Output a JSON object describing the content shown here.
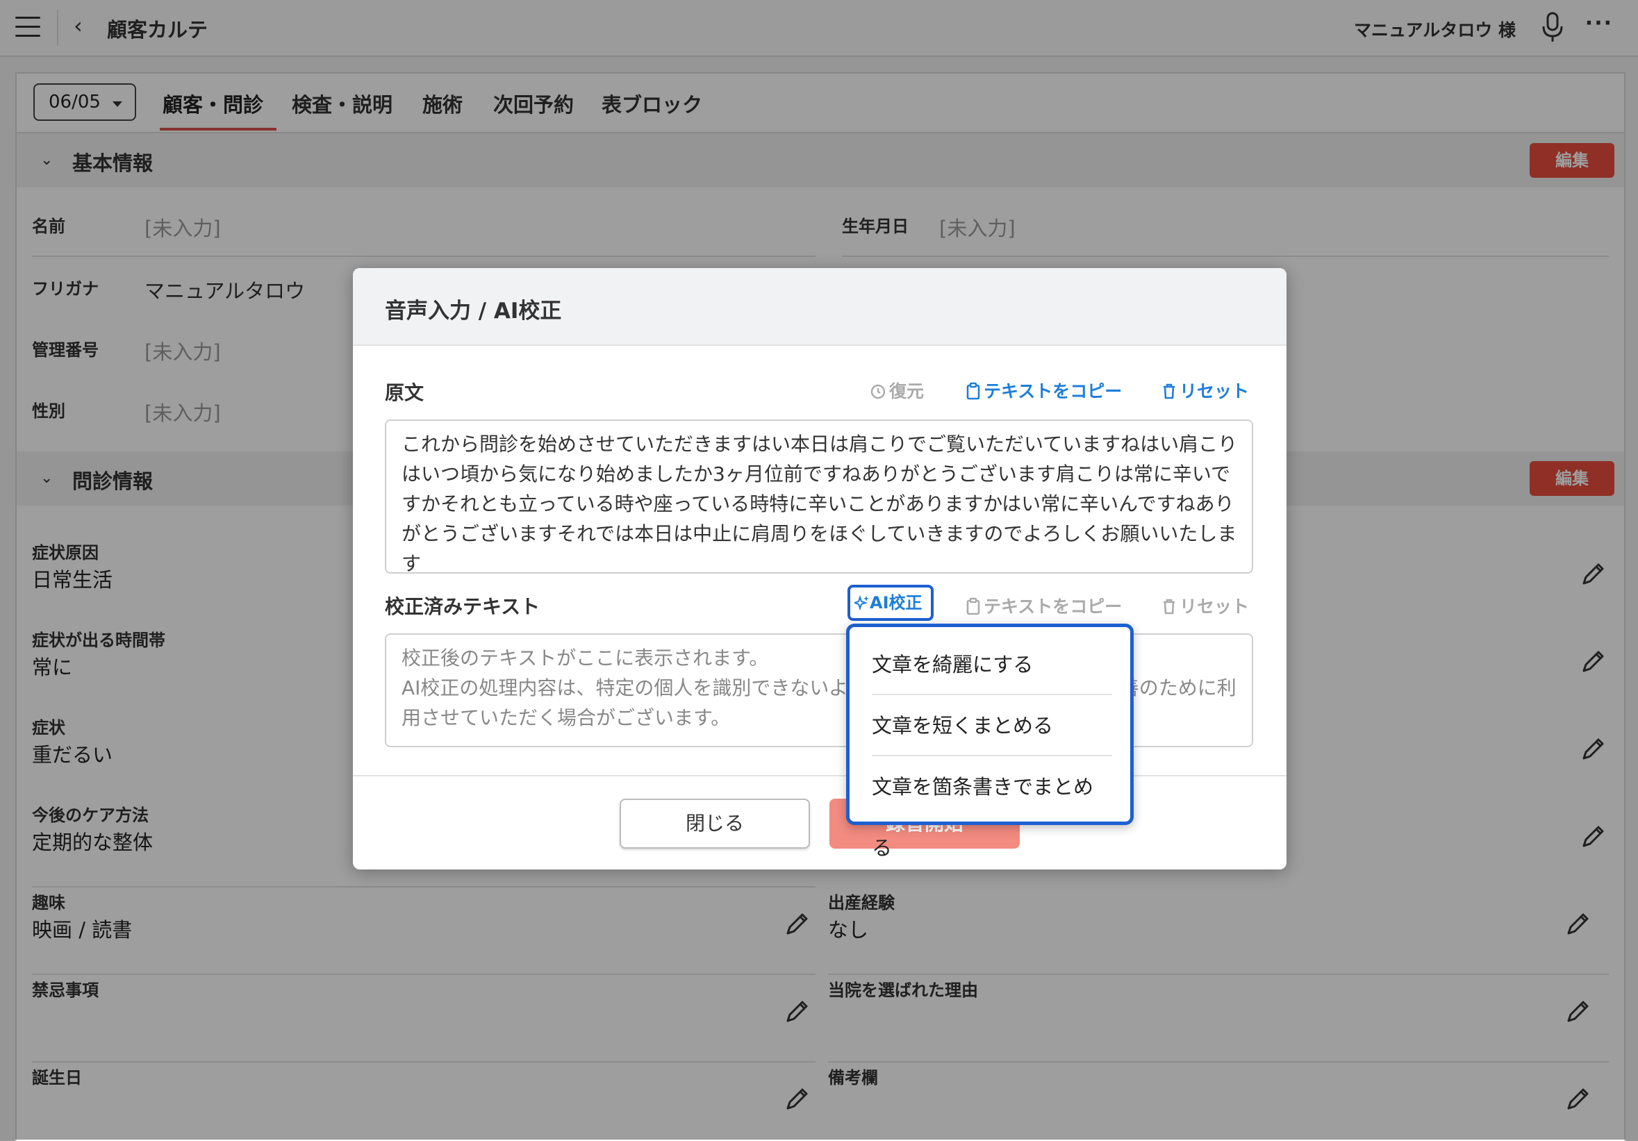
{
  "topbar": {
    "title": "顧客カルテ",
    "user": "マニュアルタロウ 様",
    "more": "···"
  },
  "tabs": {
    "date": "06/05",
    "items": [
      "顧客・問診",
      "検査・説明",
      "施術",
      "次回予約",
      "表ブロック"
    ]
  },
  "basic": {
    "header": "基本情報",
    "edit": "編集",
    "fields": [
      {
        "label": "名前",
        "value": "[未入力]"
      },
      {
        "label": "生年月日",
        "value": "[未入力]"
      },
      {
        "label": "フリガナ",
        "value": "マニュアルタロウ"
      },
      {
        "label": "管理番号",
        "value": "[未入力]"
      },
      {
        "label": "性別",
        "value": "[未入力]"
      }
    ]
  },
  "interview": {
    "header": "問診情報",
    "edit": "編集",
    "left": [
      {
        "label": "症状原因",
        "value": "日常生活"
      },
      {
        "label": "症状が出る時間帯",
        "value": "常に"
      },
      {
        "label": "症状",
        "value": "重だるい"
      },
      {
        "label": "今後のケア方法",
        "value": "定期的な整体"
      },
      {
        "label": "趣味",
        "value": "映画 / 読書"
      },
      {
        "label": "禁忌事項",
        "value": ""
      },
      {
        "label": "誕生日",
        "value": ""
      }
    ],
    "right": [
      {
        "label": "出産経験",
        "value": "なし"
      },
      {
        "label": "当院を選ばれた理由",
        "value": ""
      },
      {
        "label": "備考欄",
        "value": ""
      }
    ]
  },
  "modal": {
    "title": "音声入力 / AI校正",
    "original_label": "原文",
    "restore": "復元",
    "copy": "テキストをコピー",
    "reset": "リセット",
    "original_text": "これから問診を始めさせていただきますはい本日は肩こりでご覧いただいていますねはい肩こりはいつ頃から気になり始めましたか3ヶ月位前ですねありがとうございます肩こりは常に辛いですかそれとも立っている時や座っている時特に辛いことがありますかはい常に辛いんですねありがとうございますそれでは本日は中止に肩周りをほぐしていきますのでよろしくお願いいたします",
    "corrected_label": "校正済みテキスト",
    "ai_button": "AI校正",
    "placeholder": "校正後のテキストがここに表示されます。\nAI校正の処理内容は、特定の個人を識別できないよう匿名化した上で、サービス改善のために利用させていただく場合がございます。",
    "close": "閉じる",
    "record": "録音開始"
  },
  "dropdown": {
    "items": [
      "文章を綺麗にする",
      "文章を短くまとめる",
      "文章を箇条書きでまとめる"
    ]
  },
  "colors": {
    "accent_red": "#e74c3c",
    "link_blue": "#1e7ed8",
    "focus_blue": "#1e5fd0"
  }
}
